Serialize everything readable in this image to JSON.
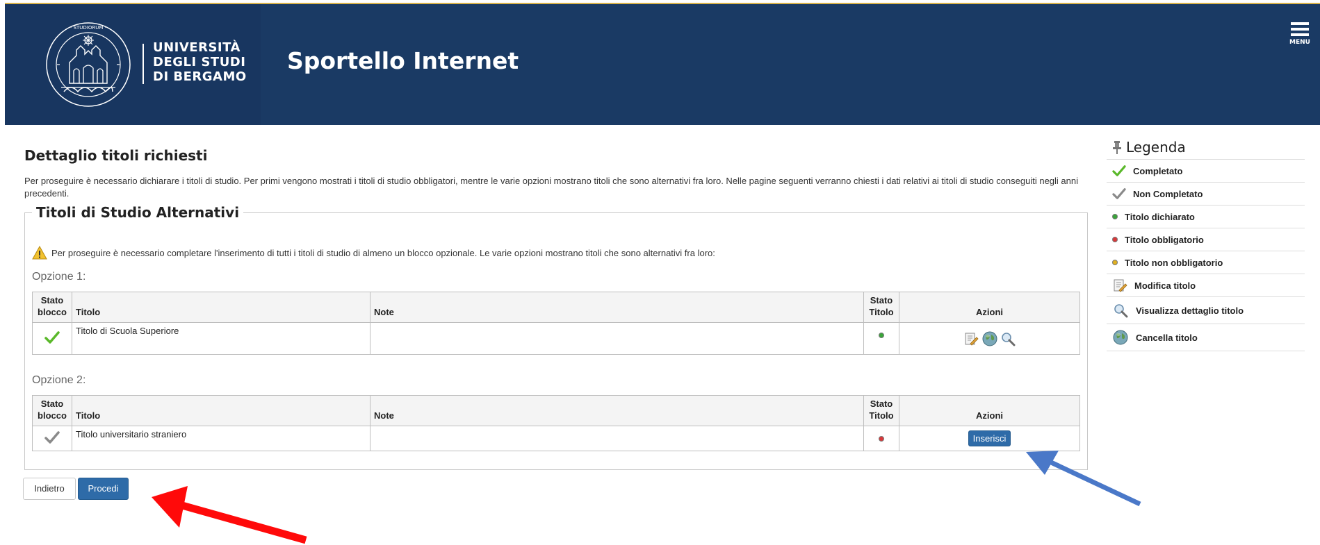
{
  "header": {
    "logo_lines": [
      "UNIVERSITÀ",
      "DEGLI STUDI",
      "DI BERGAMO"
    ],
    "site_title": "Sportello Internet",
    "menu_label": "MENU"
  },
  "main": {
    "title": "Dettaglio titoli richiesti",
    "intro": "Per proseguire è necessario dichiarare i titoli di studio. Per primi vengono mostrati i titoli di studio obbligatori, mentre le varie opzioni mostrano titoli che sono alternativi fra loro. Nelle pagine seguenti verranno chiesti i dati relativi ai titoli di studio conseguiti negli anni precedenti.",
    "fieldset_legend": "Titoli di Studio Alternativi",
    "warning": "Per proseguire è necessario completare l'inserimento di tutti i titoli di studio di almeno un blocco opzionale. Le varie opzioni mostrano titoli che sono alternativi fra loro:",
    "columns": {
      "stato_blocco_1": "Stato",
      "stato_blocco_2": "blocco",
      "titolo": "Titolo",
      "note": "Note",
      "stato_titolo_1": "Stato",
      "stato_titolo_2": "Titolo",
      "azioni": "Azioni"
    },
    "options": [
      {
        "label": "Opzione 1:",
        "row": {
          "status": "completato",
          "titolo": "Titolo di Scuola Superiore",
          "note": "",
          "stato_titolo": "dichiarato",
          "actions": [
            "edit-icon",
            "delete-icon",
            "view-icon"
          ]
        }
      },
      {
        "label": "Opzione 2:",
        "row": {
          "status": "non-completato",
          "titolo": "Titolo universitario straniero",
          "note": "",
          "stato_titolo": "obbligatorio",
          "insert_label": "Inserisci"
        }
      }
    ],
    "buttons": {
      "back": "Indietro",
      "proceed": "Procedi"
    }
  },
  "legend": {
    "title": "Legenda",
    "items": [
      {
        "icon": "check-green-icon",
        "label": "Completato"
      },
      {
        "icon": "check-gray-icon",
        "label": "Non Completato"
      },
      {
        "icon": "green-dot-icon",
        "label": "Titolo dichiarato"
      },
      {
        "icon": "red-dot-icon",
        "label": "Titolo obbligatorio"
      },
      {
        "icon": "yellow-dot-icon",
        "label": "Titolo non obbligatorio"
      },
      {
        "icon": "edit-icon",
        "label": "Modifica titolo"
      },
      {
        "icon": "magnifier-icon",
        "label": "Visualizza dettaglio titolo"
      },
      {
        "icon": "globe-icon",
        "label": "Cancella titolo"
      }
    ]
  },
  "colors": {
    "header_bg": "#1a3a64",
    "primary_button": "#2e6ba8",
    "dot_green": "#3aa53a",
    "dot_red": "#d9383a",
    "dot_yellow": "#e0b020",
    "arrow_red": "#ff0a0a",
    "arrow_blue": "#4a78c8"
  }
}
